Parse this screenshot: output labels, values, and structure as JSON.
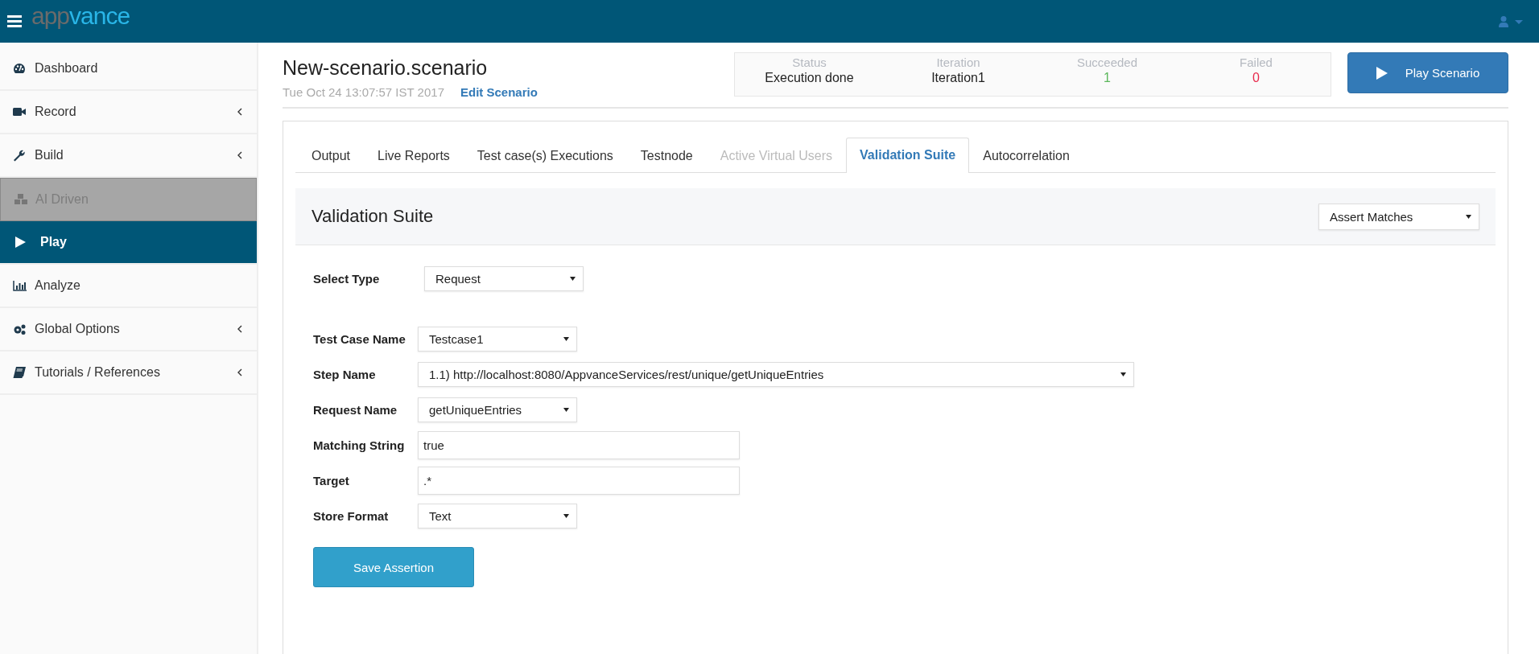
{
  "top_bar": {
    "logo": [
      "app",
      "vance"
    ]
  },
  "sidebar": {
    "items": [
      {
        "label": "Dashboard",
        "selected": false,
        "disabled": false,
        "expandable": false
      },
      {
        "label": "Record",
        "selected": false,
        "disabled": false,
        "expandable": true
      },
      {
        "label": "Build",
        "selected": false,
        "disabled": false,
        "expandable": true
      },
      {
        "label": "AI Driven",
        "selected": false,
        "disabled": true,
        "expandable": false
      },
      {
        "label": "Play",
        "selected": true,
        "disabled": false,
        "expandable": false
      },
      {
        "label": "Analyze",
        "selected": false,
        "disabled": false,
        "expandable": false
      },
      {
        "label": "Global Options",
        "selected": false,
        "disabled": false,
        "expandable": true
      },
      {
        "label": "Tutorials / References",
        "selected": false,
        "disabled": false,
        "expandable": true
      }
    ]
  },
  "header": {
    "title": "New-scenario.scenario",
    "timestamp": "Tue Oct 24 13:07:57 IST 2017",
    "edit_link": "Edit Scenario",
    "stats": [
      {
        "label": "Status",
        "value": "Execution done",
        "color": "#222222"
      },
      {
        "label": "Iteration",
        "value": "Iteration1",
        "color": "#222222"
      },
      {
        "label": "Succeeded",
        "value": "1",
        "color": "#5cb85c"
      },
      {
        "label": "Failed",
        "value": "0",
        "color": "#e8294b"
      }
    ],
    "play_button": "Play Scenario"
  },
  "tabs": [
    {
      "label": "Output",
      "selected": false,
      "disabled": false
    },
    {
      "label": "Live Reports",
      "selected": false,
      "disabled": false
    },
    {
      "label": "Test case(s) Executions",
      "selected": false,
      "disabled": false
    },
    {
      "label": "Testnode",
      "selected": false,
      "disabled": false
    },
    {
      "label": "Active Virtual Users",
      "selected": false,
      "disabled": true
    },
    {
      "label": "Validation Suite",
      "selected": true,
      "disabled": false
    },
    {
      "label": "Autocorrelation",
      "selected": false,
      "disabled": false
    }
  ],
  "panel": {
    "title": "Validation Suite",
    "assert_select": "Assert Matches",
    "select_type": {
      "label": "Select Type",
      "value": "Request"
    },
    "fields": [
      {
        "label": "Test Case Name",
        "kind": "select",
        "value": "Testcase1"
      },
      {
        "label": "Step Name",
        "kind": "select",
        "value": "1.1) http://localhost:8080/AppvanceServices/rest/unique/getUniqueEntries"
      },
      {
        "label": "Request Name",
        "kind": "select",
        "value": "getUniqueEntries"
      },
      {
        "label": "Matching String",
        "kind": "text",
        "value": "true"
      },
      {
        "label": "Target",
        "kind": "text",
        "value": ".*"
      },
      {
        "label": "Store Format",
        "kind": "select",
        "value": "Text"
      }
    ],
    "save_button": "Save Assertion"
  }
}
